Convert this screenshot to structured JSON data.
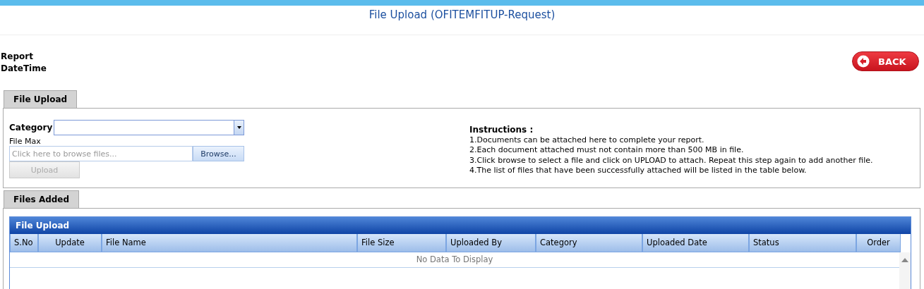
{
  "page_title": "File Upload (OFITEMFITUP-Request)",
  "report_labels": [
    "Report",
    "DateTime"
  ],
  "back_button": {
    "label": "BACK"
  },
  "upload_section": {
    "tab": "File Upload",
    "category_label": "Category",
    "file_max_label": "File Max",
    "file_field": {
      "placeholder": "Click here to browse files..."
    },
    "browse_button": "Browse...",
    "upload_button": {
      "label": "Upload",
      "disabled": true
    },
    "instructions": {
      "heading": "Instructions :",
      "lines": [
        "1.Documents can be attached here to complete your report.",
        "2.Each document attached must not contain more than 500 MB in file.",
        "3.Click browse to select a file and click on UPLOAD to attach. Repeat this step again to add another file.",
        "4.The list of files that have been successfully attached will be listed in the table below."
      ]
    }
  },
  "files_section": {
    "tab": "Files Added",
    "grid_title": "File Upload",
    "columns": [
      "S.No",
      "Update",
      "File Name",
      "File Size",
      "Uploaded By",
      "Category",
      "Uploaded Date",
      "Status",
      "Order"
    ],
    "empty_message": "No Data To Display"
  }
}
